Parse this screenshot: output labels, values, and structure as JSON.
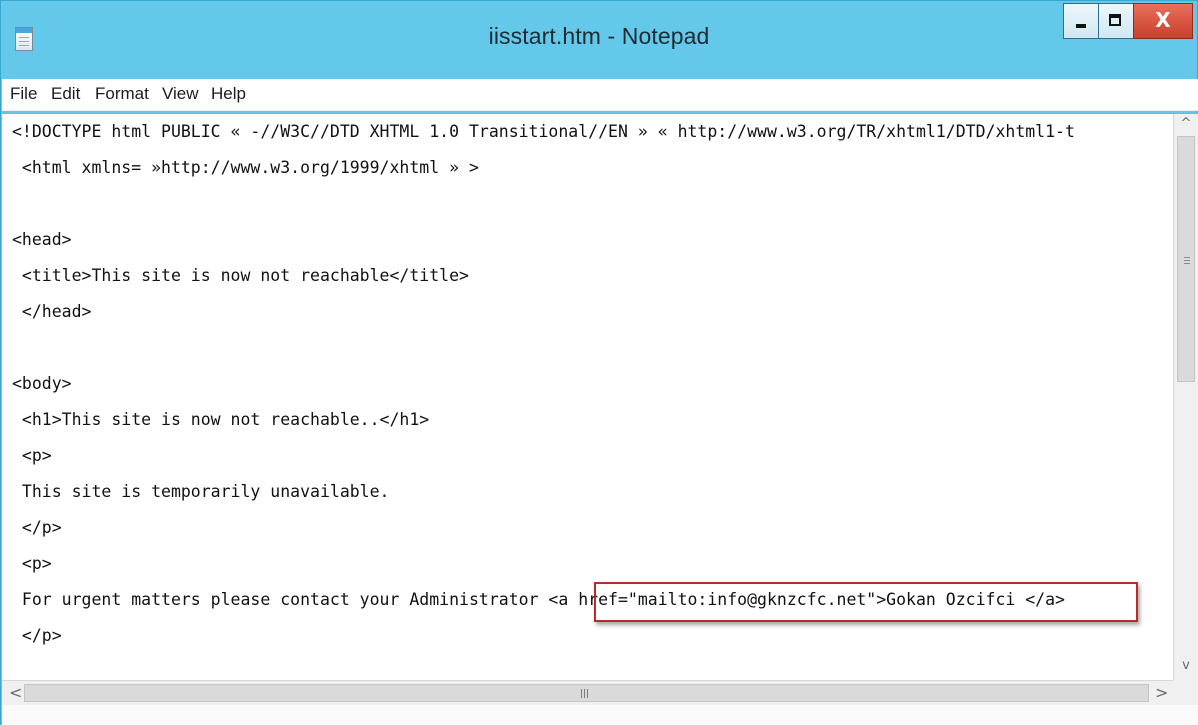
{
  "window": {
    "title": "iisstart.htm - Notepad"
  },
  "controls": {
    "minimize_icon": "minimize-icon",
    "maximize_icon": "maximize-icon",
    "close_glyph": "X"
  },
  "menu": [
    "File",
    "Edit",
    "Format",
    "View",
    "Help"
  ],
  "editor": {
    "lines": [
      "<!DOCTYPE html PUBLIC « -//W3C//DTD XHTML 1.0 Transitional//EN » « http://www.w3.org/TR/xhtml1/DTD/xhtml1-t",
      " <html xmlns= »http://www.w3.org/1999/xhtml » >",
      "",
      "<head>",
      " <title>This site is now not reachable</title>",
      " </head>",
      "",
      "<body>",
      " <h1>This site is now not reachable..</h1>",
      " <p>",
      " This site is temporarily unavailable.",
      " </p>",
      " <p>",
      " For urgent matters please contact your Administrator <a href=\"mailto:info@gknzcfc.net\">Gokan Ozcifci </a>",
      " </p>"
    ],
    "highlight_color": "#b92a2a"
  },
  "scrollbars": {
    "up_arrow": "^",
    "down_arrow": "v",
    "left_arrow": "<",
    "right_arrow": ">",
    "grip_glyph": "≡",
    "hgrip_glyph": "III"
  },
  "colors": {
    "titlebar": "#64c8ea",
    "close_button": "#c9412d"
  }
}
